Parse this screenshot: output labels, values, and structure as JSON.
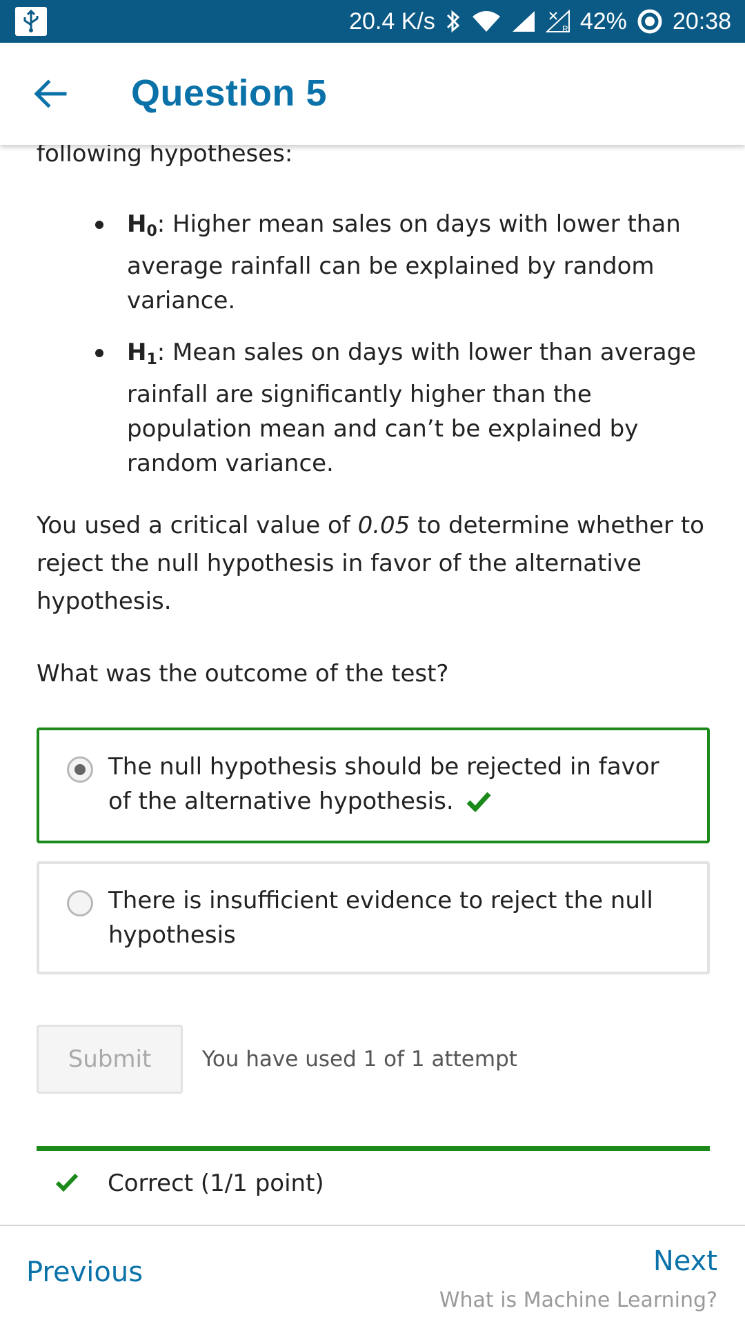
{
  "status_bar": {
    "net_speed": "20.4 K/s",
    "battery": "42%",
    "time": "20:38",
    "icons": [
      "usb-icon",
      "bluetooth-icon",
      "wifi-icon",
      "signal-icon",
      "roaming-signal-icon",
      "battery-saver-icon"
    ]
  },
  "app_bar": {
    "title": "Question 5",
    "back_icon": "arrow-left-icon"
  },
  "content": {
    "partial_text": "following hypotheses:",
    "hypotheses": [
      {
        "label": "H",
        "sub": "0",
        "text": ": Higher mean sales on days with lower than average rainfall can be explained by random variance."
      },
      {
        "label": "H",
        "sub": "1",
        "text": ": Mean sales on days with lower than average rainfall are significantly higher than the population mean and can’t be explained by random variance."
      }
    ],
    "critical_prefix": "You used a critical value of ",
    "critical_value": "0.05",
    "critical_suffix": " to determine whether to reject the null hypothesis in favor of the alternative hypothesis.",
    "question": "What was the outcome of the test?"
  },
  "options": [
    {
      "text": "The null hypothesis should be rejected in favor of the alternative hypothesis.",
      "selected": true,
      "correct": true
    },
    {
      "text": "There is insufficient evidence to reject the null hypothesis",
      "selected": false,
      "correct": false
    }
  ],
  "submit": {
    "label": "Submit",
    "attempts_text": "You have used 1 of 1 attempt"
  },
  "result": {
    "text": "Correct (1/1 point)"
  },
  "nav": {
    "previous": "Previous",
    "next": "Next",
    "next_subtitle": "What is Machine Learning?"
  },
  "colors": {
    "status_bar": "#0b5a86",
    "accent": "#0a72a8",
    "correct": "#1b8a1b"
  }
}
